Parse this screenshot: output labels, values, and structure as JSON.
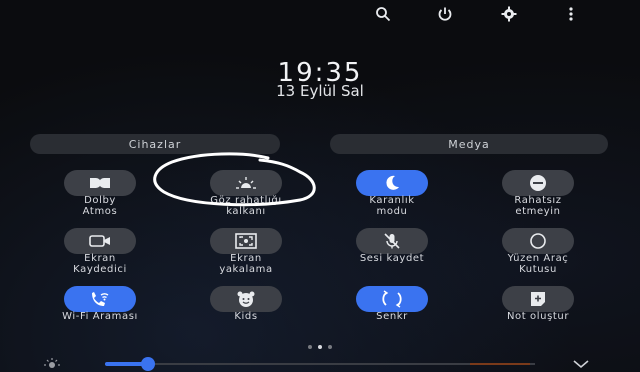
{
  "clock": {
    "time": "19:35",
    "date": "13 Eylül Sal"
  },
  "sections": {
    "devices": "Cihazlar",
    "media": "Medya"
  },
  "tiles": [
    {
      "label_1": "Dolby",
      "label_2": "Atmos",
      "icon": "dolby-icon",
      "on": false
    },
    {
      "label_1": "Göz rahatlığı",
      "label_2": "kalkanı",
      "icon": "sun-icon",
      "on": false
    },
    {
      "label_1": "Karanlık",
      "label_2": "modu",
      "icon": "moon-icon",
      "on": true
    },
    {
      "label_1": "Rahatsız",
      "label_2": "etmeyin",
      "icon": "minus-circle-icon",
      "on": false
    },
    {
      "label_1": "Ekran",
      "label_2": "Kaydedici",
      "icon": "video-icon",
      "on": false
    },
    {
      "label_1": "Ekran",
      "label_2": "yakalama",
      "icon": "screenshot-icon",
      "on": false
    },
    {
      "label_1": "Sesi kaydet",
      "label_2": "",
      "icon": "mic-off-icon",
      "on": false
    },
    {
      "label_1": "Yüzen Araç",
      "label_2": "Kutusu",
      "icon": "circle-icon",
      "on": false
    },
    {
      "label_1": "Wi-Fi Araması",
      "label_2": "",
      "icon": "wifi-call-icon",
      "on": true
    },
    {
      "label_1": "Kids",
      "label_2": "",
      "icon": "kids-icon",
      "on": false
    },
    {
      "label_1": "Senkr",
      "label_2": "",
      "icon": "sync-icon",
      "on": true
    },
    {
      "label_1": "Not oluştur",
      "label_2": "",
      "icon": "note-add-icon",
      "on": false
    }
  ],
  "brightness": {
    "level_percent": 10
  },
  "pager": {
    "pages": 3,
    "current": 2
  },
  "colors": {
    "accent": "#3a73f0",
    "tile_off": "#3d4047",
    "background": "#0b0c0f"
  }
}
